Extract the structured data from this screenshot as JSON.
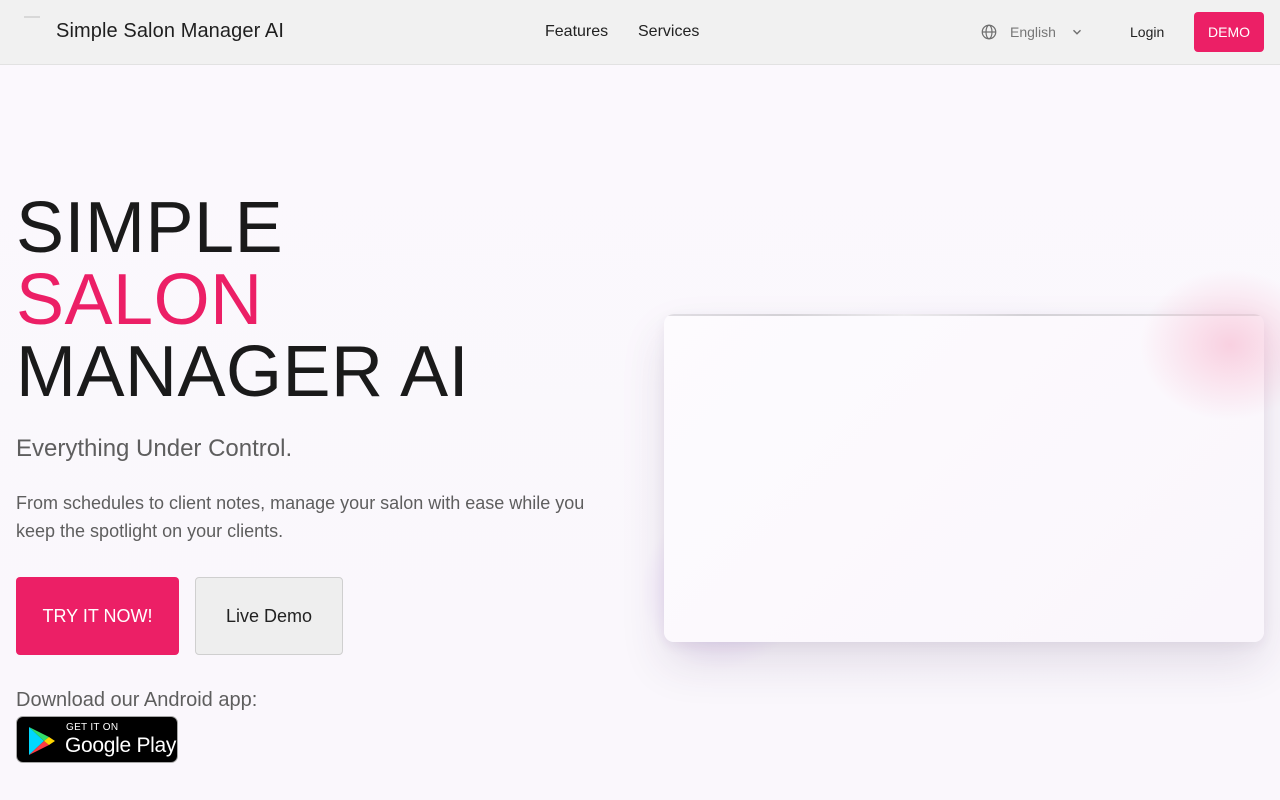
{
  "header": {
    "brand_name": "Simple Salon Manager AI",
    "nav": [
      {
        "label": "Features"
      },
      {
        "label": "Services"
      }
    ],
    "language": {
      "label": "English",
      "icon": "globe-icon",
      "chevron": "chevron-down-icon"
    },
    "login_label": "Login",
    "demo_label": "DEMO"
  },
  "hero": {
    "title_lines": [
      "SIMPLE",
      "SALON",
      "MANAGER AI"
    ],
    "tagline": "Everything Under Control.",
    "description": "From schedules to client notes, manage your salon with ease while you keep the spotlight on your clients.",
    "primary_cta": "TRY IT NOW!",
    "secondary_cta": "Live Demo",
    "download_label": "Download our Android app:",
    "google_play": {
      "small": "GET IT ON",
      "big": "Google Play",
      "icon": "google-play-icon"
    }
  },
  "colors": {
    "accent": "#ec1f66",
    "header_bg": "#f1f1f1",
    "page_bg": "#faf7fc",
    "text_muted": "#5e5e5e"
  }
}
